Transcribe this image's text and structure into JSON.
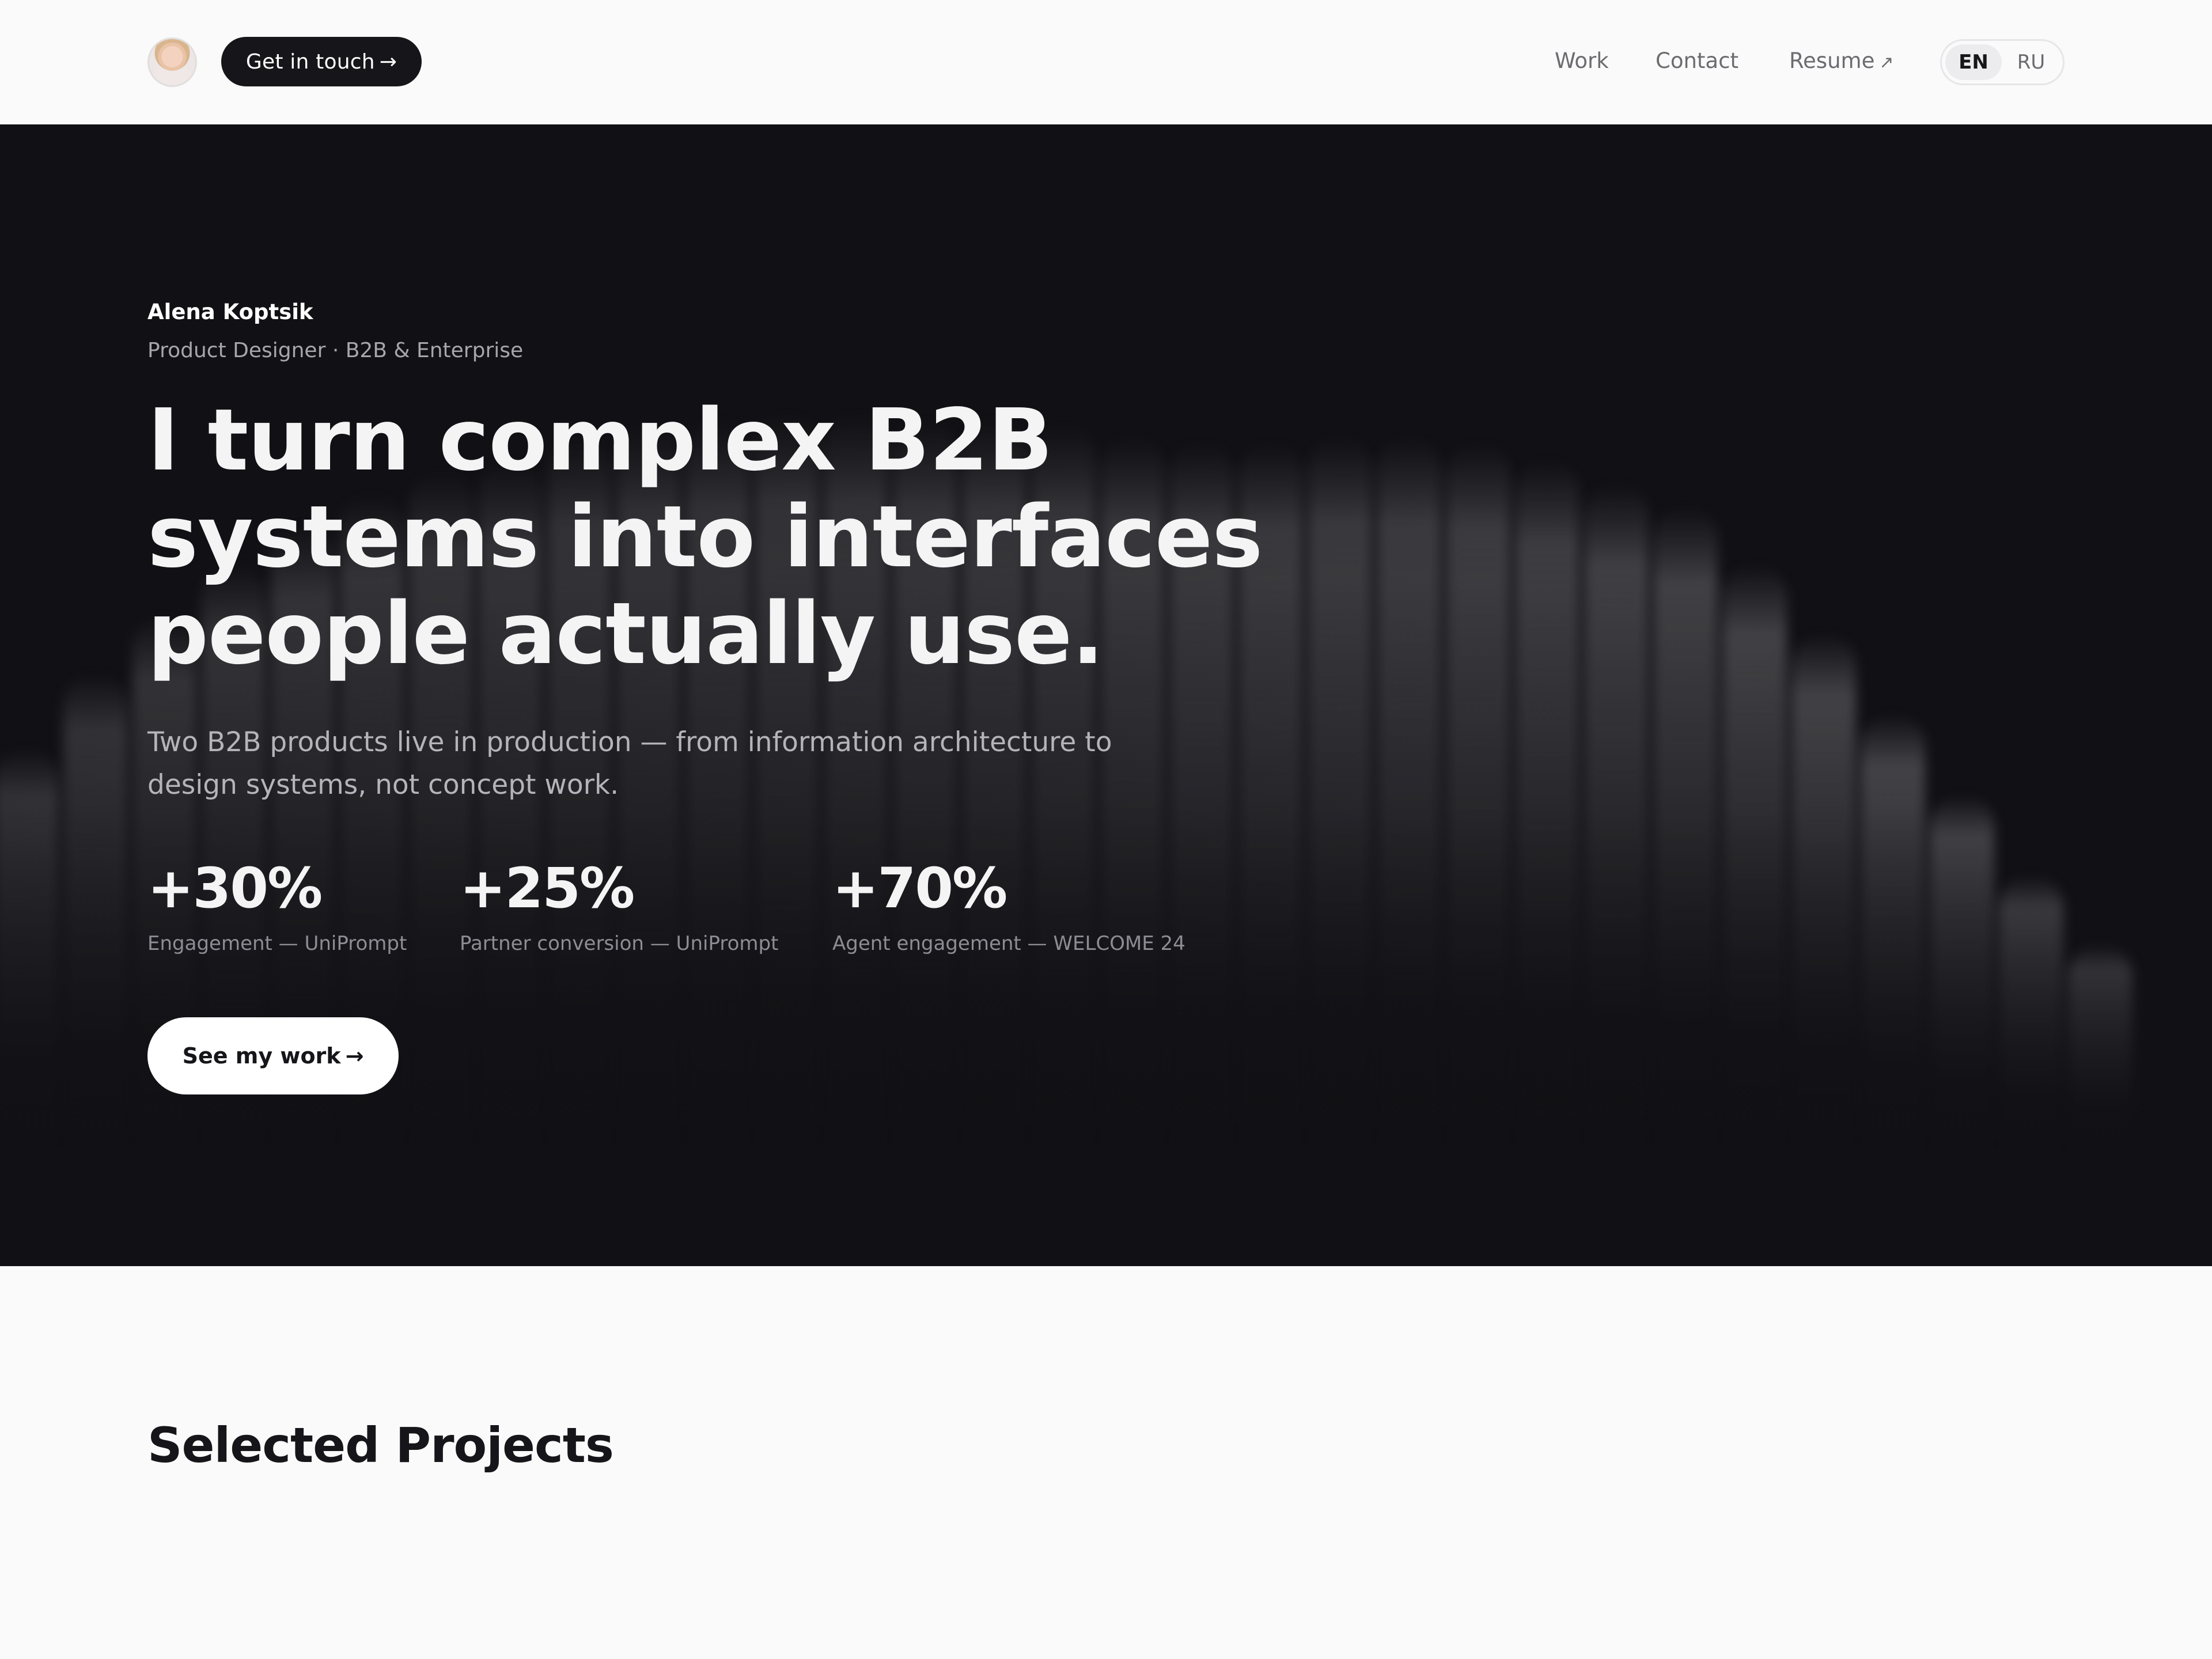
{
  "header": {
    "cta_label": "Get in touch",
    "cta_arrow": "→",
    "nav": {
      "work": "Work",
      "contact": "Contact",
      "resume": "Resume",
      "resume_icon": "↗"
    },
    "languages": [
      "EN",
      "RU"
    ],
    "active_language": "EN"
  },
  "hero": {
    "name": "Alena Koptsik",
    "role": "Product Designer · B2B & Enterprise",
    "title": "I turn complex B2B systems into interfaces people actually use.",
    "description": "Two B2B products live in production — from information architecture to design systems, not concept work.",
    "stats": [
      {
        "value": "+30%",
        "label": "Engagement — UniPrompt"
      },
      {
        "value": "+25%",
        "label": "Partner conversion — UniPrompt"
      },
      {
        "value": "+70%",
        "label": "Agent engagement — WELCOME 24"
      }
    ],
    "cta_label": "See my work",
    "cta_arrow": "→"
  },
  "section": {
    "title": "Selected Projects"
  },
  "colors": {
    "hero_background": "#111115",
    "page_background": "#fafafa",
    "primary_button": "#16161a"
  }
}
